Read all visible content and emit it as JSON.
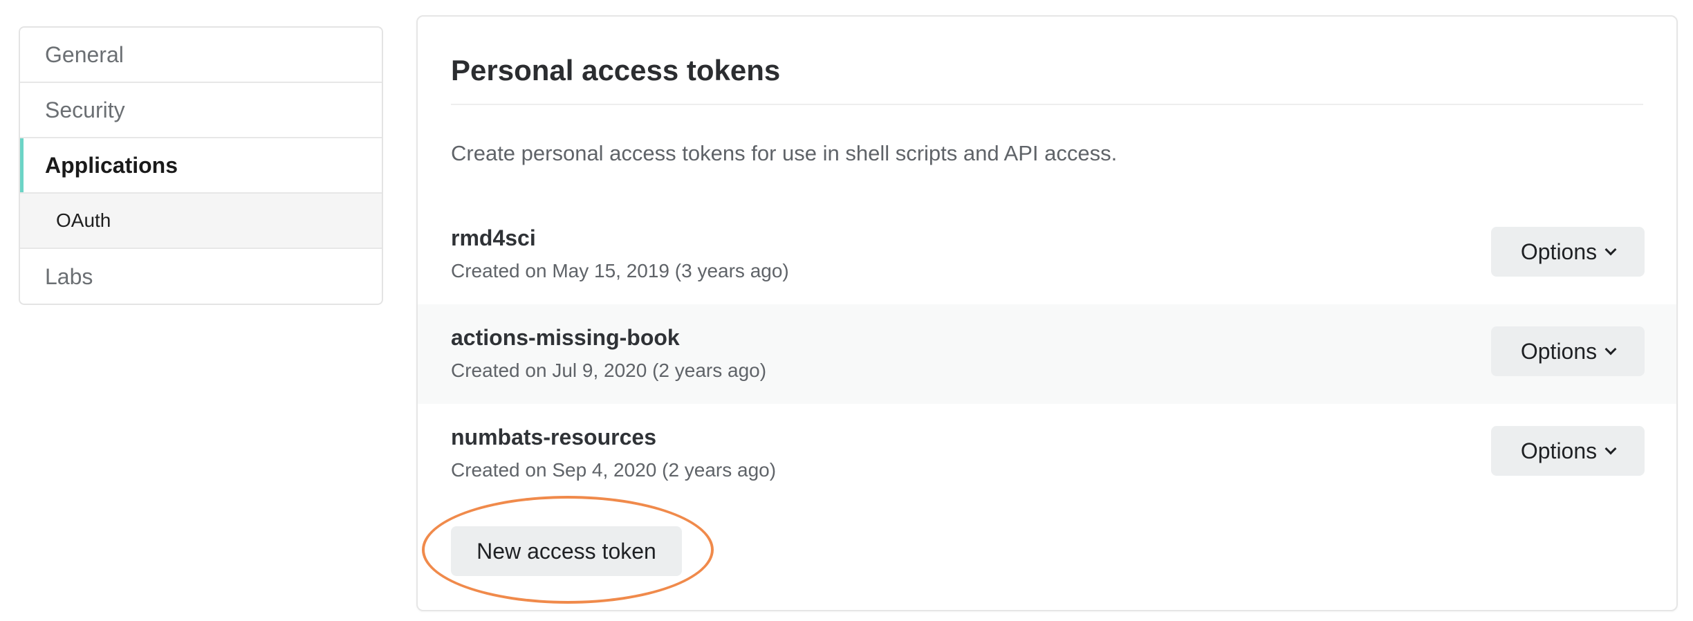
{
  "sidebar": {
    "items": [
      {
        "label": "General"
      },
      {
        "label": "Security"
      },
      {
        "label": "Applications"
      },
      {
        "label": "OAuth"
      },
      {
        "label": "Labs"
      }
    ]
  },
  "panel": {
    "title": "Personal access tokens",
    "description": "Create personal access tokens for use in shell scripts and API access.",
    "tokens": [
      {
        "name": "rmd4sci",
        "created": "Created on May 15, 2019 (3 years ago)",
        "options_label": "Options"
      },
      {
        "name": "actions-missing-book",
        "created": "Created on Jul 9, 2020 (2 years ago)",
        "options_label": "Options"
      },
      {
        "name": "numbats-resources",
        "created": "Created on Sep 4, 2020 (2 years ago)",
        "options_label": "Options"
      }
    ],
    "new_token_label": "New access token"
  },
  "colors": {
    "active_indicator": "#6cd4c6",
    "highlight_ring": "#f08a4b",
    "button_bg": "#eceeef"
  },
  "icons": {
    "options_chevron": "chevron-down-icon"
  }
}
